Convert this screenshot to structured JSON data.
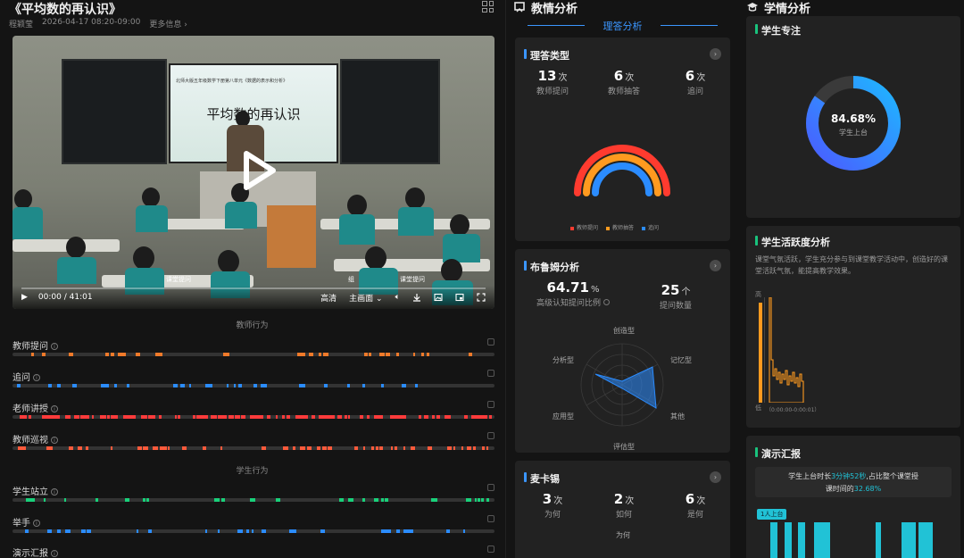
{
  "lesson": {
    "title": "《平均数的再认识》",
    "teacher": "程颖莹",
    "datetime": "2026-04-17 08:20-09:00",
    "more": "更多信息",
    "more_arrow": "›"
  },
  "video": {
    "slide_small_text": "北师大版五年级数学下册第八单元《数据的表示和分析》",
    "slide_title": "平均数的再认识",
    "in_video_labels": [
      "课堂提问",
      "组",
      "课堂提问"
    ],
    "time": "00:00 / 41:01",
    "quality": "高清",
    "view": "主画面",
    "view_chevron": "⌄"
  },
  "behaviors": {
    "teacher_section": "教师行为",
    "student_section": "学生行为",
    "tracks": [
      {
        "name": "教师提问",
        "color": "#f07a2a"
      },
      {
        "name": "追问",
        "color": "#2b8cff"
      },
      {
        "name": "老师讲授",
        "color": "#ff3b3b"
      },
      {
        "name": "教师巡视",
        "color": "#ff5a3b"
      },
      {
        "name": "学生站立",
        "color": "#19d07a"
      },
      {
        "name": "举手",
        "color": "#2b8cff"
      },
      {
        "name": "演示汇报",
        "color": "#21c2d6"
      }
    ]
  },
  "teaching": {
    "heading": "教情分析",
    "subtab": "理答分析",
    "response_types": {
      "title": "理答类型",
      "more": "›",
      "stats": [
        {
          "value": "13",
          "unit": "次",
          "label": "教师提问"
        },
        {
          "value": "6",
          "unit": "次",
          "label": "教师抽答"
        },
        {
          "value": "6",
          "unit": "次",
          "label": "追问"
        }
      ],
      "legend": [
        "教师提问",
        "教师抽答",
        "追问"
      ],
      "ring_values": [
        13,
        6,
        6
      ],
      "colors": [
        "#ff3b2f",
        "#ff9a1f",
        "#2b8cff"
      ]
    },
    "bloom": {
      "title": "布鲁姆分析",
      "more": "›",
      "high_ratio": "64.71",
      "high_ratio_unit": "%",
      "high_label": "高级认知提问比例",
      "count": "25",
      "count_unit": "个",
      "count_label": "提问数量",
      "axes": [
        "创造型",
        "记忆型",
        "其他",
        "评估型",
        "应用型",
        "分析型"
      ]
    },
    "mckinsey": {
      "title": "麦卡锡",
      "more": "›",
      "stats": [
        {
          "value": "3",
          "unit": "次",
          "label": "为何"
        },
        {
          "value": "2",
          "unit": "次",
          "label": "如何"
        },
        {
          "value": "6",
          "unit": "次",
          "label": "是何"
        }
      ],
      "bottom_label": "为何"
    }
  },
  "learning": {
    "heading": "学情分析",
    "focus": {
      "title": "学生专注",
      "value": "84.68%",
      "label": "学生上台",
      "ratio": 0.8468
    },
    "activity": {
      "title": "学生活跃度分析",
      "desc": "课堂气氛活跃，学生充分参与到课堂教学活动中，创造好的课堂活跃气氛，能提高教学效果。",
      "high": "高",
      "low": "低",
      "axis_note": "（0:00:00-0:00:01）"
    },
    "report": {
      "title": "演示汇报",
      "line1_pre": "学生上台时长",
      "line1_hl": "3分钟52秒",
      "line1_post": ",占比整个课堂授",
      "line2_pre": "课时间的",
      "line2_hl": "32.68%",
      "badge": "1人上台"
    }
  }
}
